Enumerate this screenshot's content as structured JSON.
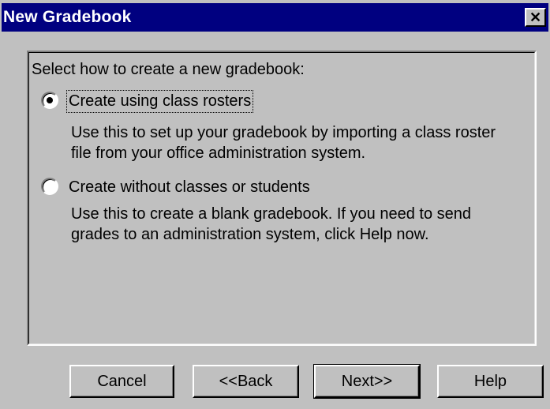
{
  "window": {
    "title": "New Gradebook",
    "close_glyph": "✕"
  },
  "group": {
    "prompt": "Select how to create a new gradebook:",
    "options": [
      {
        "label": "Create using class rosters",
        "description": "Use this to set up your gradebook by importing a class roster file from your office administration system.",
        "selected": true
      },
      {
        "label": "Create without classes or students",
        "description": "Use this to create a blank gradebook. If you need to send grades to an administration system, click Help now.",
        "selected": false
      }
    ]
  },
  "buttons": {
    "cancel": "Cancel",
    "back": "<<Back",
    "next": "Next>>",
    "help": "Help"
  }
}
